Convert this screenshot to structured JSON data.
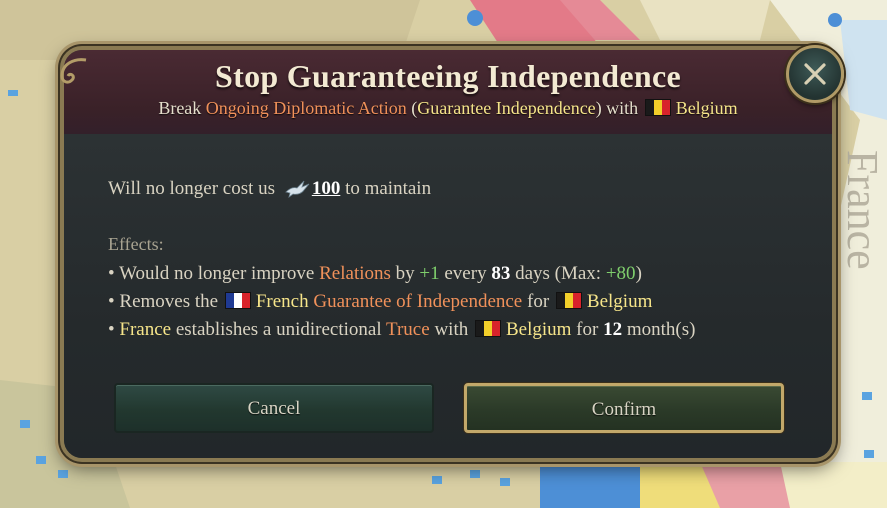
{
  "dialog": {
    "title": "Stop Guaranteeing Independence",
    "subtitle": {
      "prefix": "Break ",
      "action_type": "Ongoing Diplomatic Action",
      "open_paren": " (",
      "action_name": "Guarantee Independence",
      "close_with": ") with ",
      "target": "Belgium"
    },
    "cost": {
      "prefix": "Will no longer cost us",
      "amount": "100",
      "suffix": "to maintain",
      "icon": "dove-icon"
    },
    "effects_label": "Effects:",
    "effects": {
      "line1": {
        "bullet": "• ",
        "prefix": "Would no longer improve ",
        "stat": "Relations",
        "by": " by ",
        "amount": "+1",
        "every": " every ",
        "days": "83",
        "days_label": " days (Max: ",
        "max": "+80",
        "close": ")"
      },
      "line2": {
        "bullet": "• ",
        "prefix": "Removes the ",
        "country": "French",
        "modifier": "Guarantee of Independence",
        "for": " for ",
        "target": "Belgium"
      },
      "line3": {
        "bullet": "• ",
        "actor": "France",
        "text": " establishes a unidirectional ",
        "truce": "Truce",
        "with": " with ",
        "target": "Belgium",
        "for": " for ",
        "months": "12",
        "months_label": " month(s)"
      }
    },
    "buttons": {
      "cancel": "Cancel",
      "confirm": "Confirm"
    }
  },
  "colors": {
    "highlight_orange": "#f0915a",
    "highlight_yellow": "#f6e58a",
    "positive_green": "#7fcf6c",
    "belgium_flag": [
      "#1a1a1a",
      "#f2cf2a",
      "#d8232b"
    ],
    "france_flag": [
      "#1f3a93",
      "#ffffff",
      "#d8232b"
    ]
  }
}
